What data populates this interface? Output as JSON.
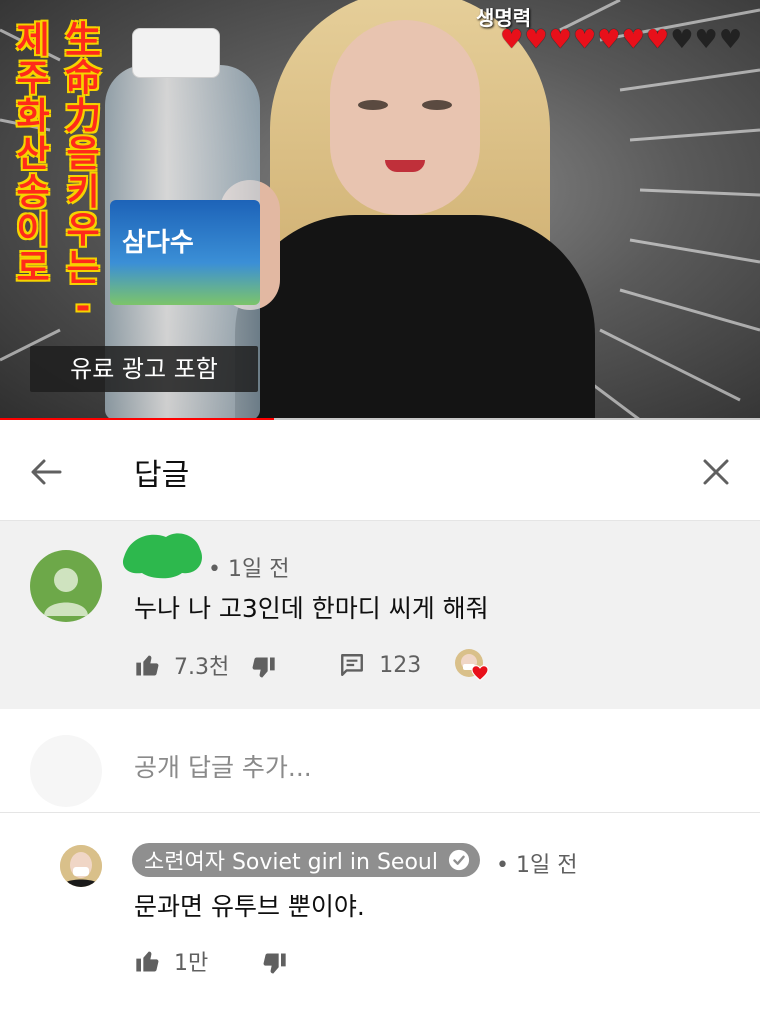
{
  "video": {
    "title_col_left": "제주 화산송이로",
    "title_col_right": "生命力을 키우는-",
    "bottle_label": "삼다수",
    "hp_label": "생명력",
    "hearts_total": 10,
    "hearts_full": 7,
    "ad_badge": "유료 광고 포함",
    "progress": 0.36
  },
  "header": {
    "title": "답글",
    "back_icon": "arrow-left-icon",
    "close_icon": "close-icon"
  },
  "parent_comment": {
    "author_hidden": true,
    "meta": "• 1일 전",
    "text": "누나 나 고3인데 한마디 씨게 해줘",
    "likes": "7.3천",
    "reply_count": "123",
    "creator_heart": true
  },
  "add_reply": {
    "placeholder": "공개 답글 추가..."
  },
  "reply": {
    "author": "소련여자 Soviet girl in Seoul",
    "verified": true,
    "meta": "• 1일 전",
    "text": "문과면 유투브 뿐이야.",
    "likes": "1만"
  },
  "colors": {
    "accent_red": "#ff0000",
    "avatar_green": "#6da849",
    "scribble_green": "#2db84d",
    "chip_gray": "#8f8f8f"
  }
}
